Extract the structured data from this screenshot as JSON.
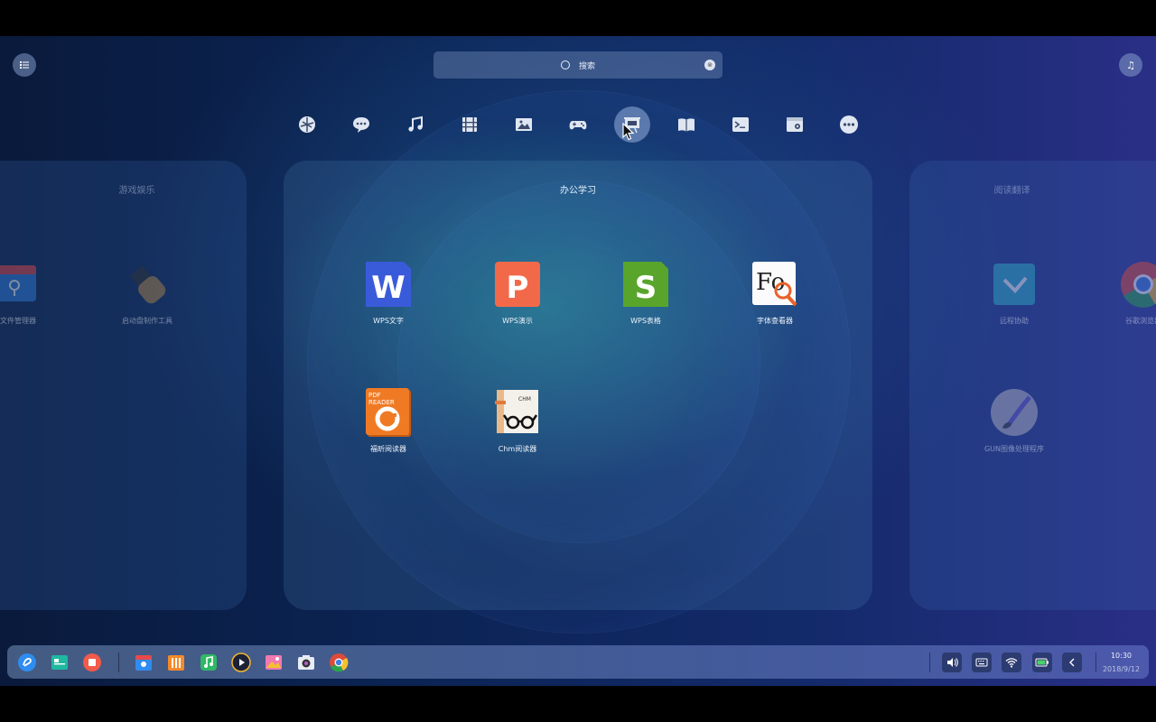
{
  "search": {
    "placeholder": "搜索"
  },
  "top_right_button": {
    "label": "♫"
  },
  "categories": [
    {
      "icon": "internet-icon"
    },
    {
      "icon": "chat-icon"
    },
    {
      "icon": "music-icon"
    },
    {
      "icon": "video-icon"
    },
    {
      "icon": "image-icon"
    },
    {
      "icon": "gamepad-icon"
    },
    {
      "icon": "office-icon",
      "active": true
    },
    {
      "icon": "reading-icon"
    },
    {
      "icon": "terminal-icon"
    },
    {
      "icon": "system-icon"
    },
    {
      "icon": "more-icon"
    }
  ],
  "panels": {
    "left": {
      "title": "游戏娱乐",
      "apps": [
        {
          "label": "度文件管理器"
        },
        {
          "label": "启动盘制作工具"
        }
      ]
    },
    "center": {
      "title": "办公学习",
      "apps": [
        {
          "label": "WPS文字",
          "icon": "wps-writer-icon"
        },
        {
          "label": "WPS演示",
          "icon": "wps-presentation-icon"
        },
        {
          "label": "WPS表格",
          "icon": "wps-spreadsheet-icon"
        },
        {
          "label": "字体查看器",
          "icon": "font-viewer-icon"
        },
        {
          "label": "福昕阅读器",
          "icon": "foxit-reader-icon"
        },
        {
          "label": "Chm阅读器",
          "icon": "chm-reader-icon"
        }
      ]
    },
    "right": {
      "title": "阅读翻译",
      "apps": [
        {
          "label": "远程协助"
        },
        {
          "label": "谷歌浏览器"
        },
        {
          "label": "GUN图像处理程序"
        }
      ]
    }
  },
  "tile_text": {
    "wps_w": "W",
    "wps_p": "P",
    "wps_s": "S",
    "font": "Fo",
    "foxit_line1": "PDF",
    "foxit_line2": "READER",
    "chm": "CHM"
  },
  "dock": {
    "apps": [
      "launcher-icon",
      "multitasking-icon",
      "shutdown-icon",
      "app-store-icon",
      "file-manager-icon",
      "music-player-icon",
      "video-player-icon",
      "image-viewer-icon",
      "camera-icon",
      "chrome-icon"
    ],
    "tray": [
      "volume-icon",
      "keyboard-icon",
      "wifi-icon",
      "battery-icon",
      "collapse-icon"
    ],
    "time": "10:30",
    "date": "2018/9/12"
  },
  "colors": {
    "accent": "#2f8cf0",
    "wps_w": "#3a5bd9",
    "wps_p": "#f2694a",
    "wps_s": "#59a52c",
    "foxit": "#f07a24"
  }
}
